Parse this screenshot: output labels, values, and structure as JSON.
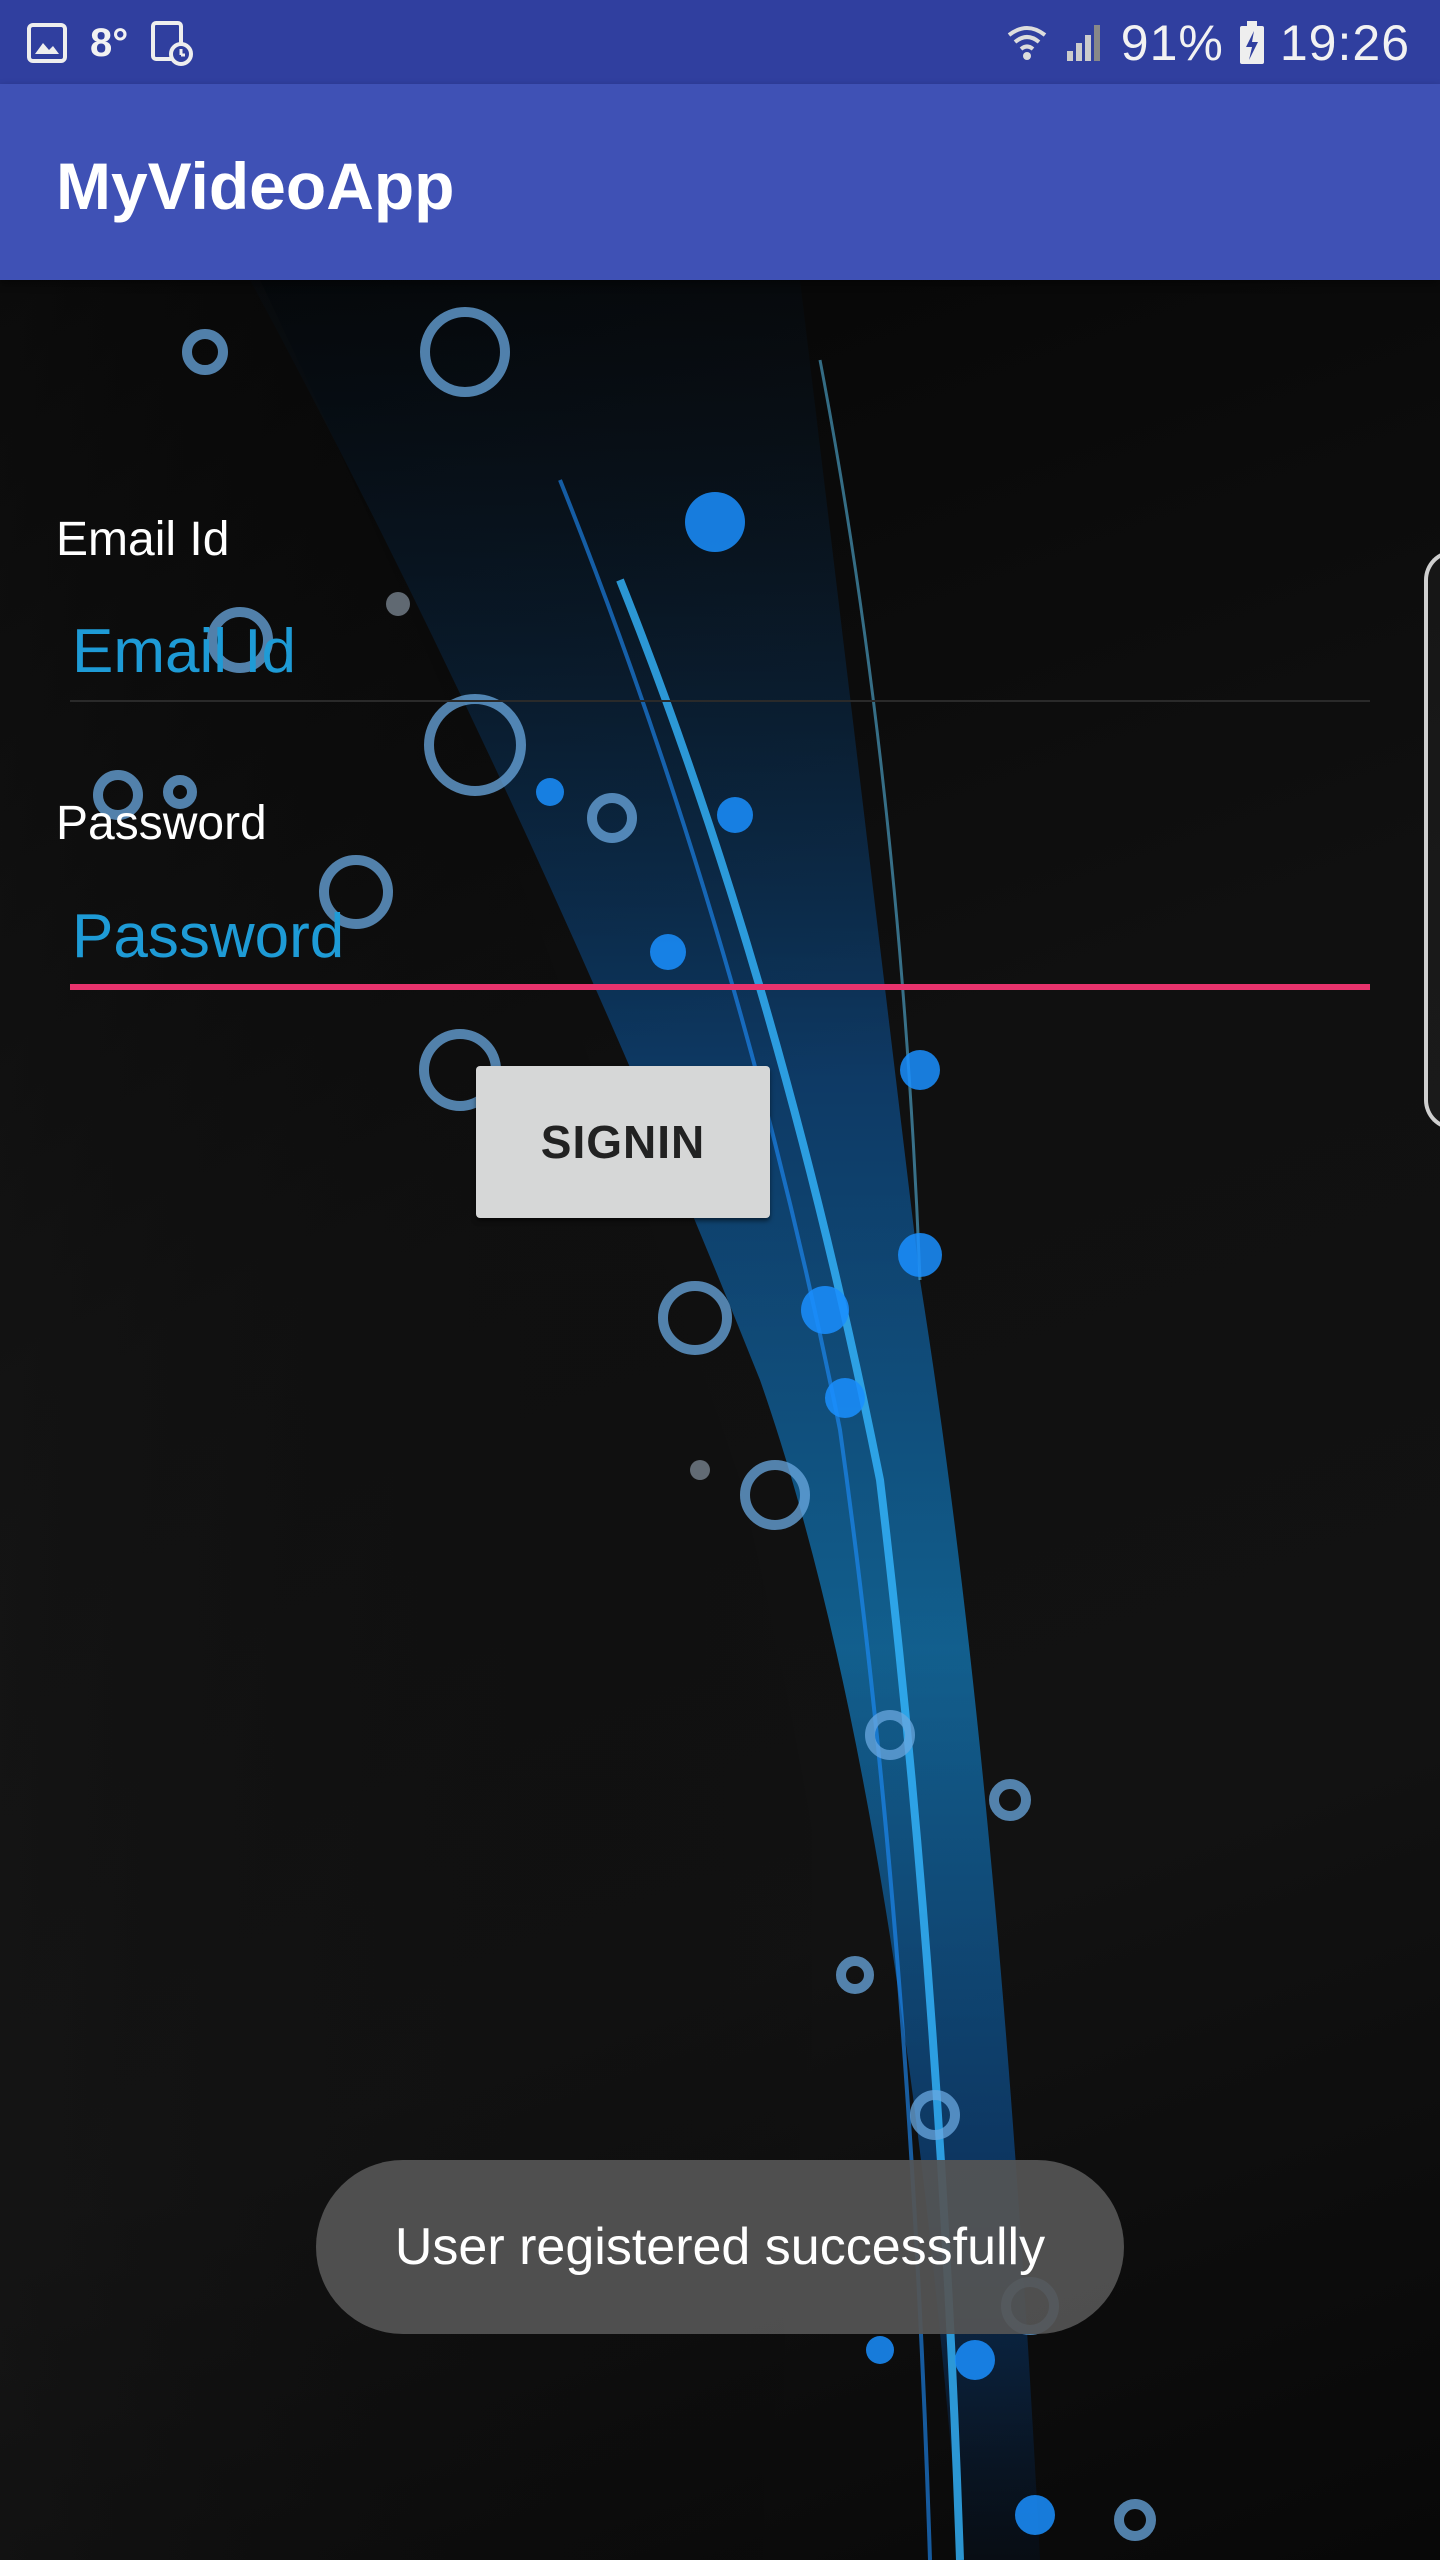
{
  "status_bar": {
    "notification_icons": [
      "image-icon",
      "temperature-icon",
      "screenshot-icon"
    ],
    "temperature": "8°",
    "battery": "91%",
    "time": "19:26",
    "system_icons": [
      "wifi-icon",
      "signal-icon",
      "battery-charging-icon"
    ]
  },
  "app_bar": {
    "title": "MyVideoApp",
    "color": "#3f51b5"
  },
  "form": {
    "email_label": "Email Id",
    "email_placeholder": "Email Id",
    "email_value": "",
    "password_label": "Password",
    "password_placeholder": "Password",
    "password_value": "",
    "focused_field": "password",
    "accent_color": "#e8336d",
    "hint_color": "#1e9bd6"
  },
  "signin_button": {
    "label": "SIGNIN"
  },
  "toast": {
    "message": "User registered successfully"
  }
}
